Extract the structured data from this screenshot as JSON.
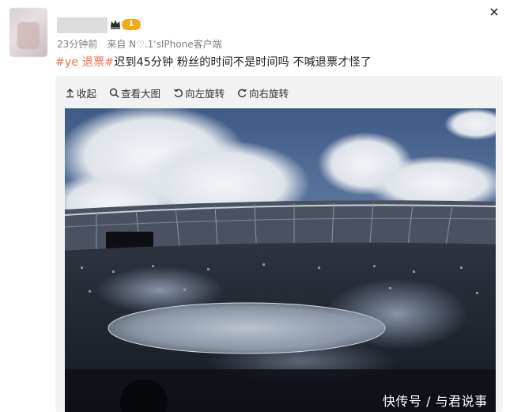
{
  "post": {
    "username": "",
    "level": "1",
    "time": "23分钟前",
    "source_prefix": "来自",
    "source_name": "N♡.1'sIPhone客户端",
    "text_tag1": "#ye 退票#",
    "text_body": "迟到45分钟 粉丝的时间不是时间吗 不喊退票才怪了"
  },
  "toolbar": {
    "collapse_label": "收起",
    "view_large_label": "查看大图",
    "rotate_left_label": "向左旋转",
    "rotate_right_label": "向右旋转"
  },
  "watermark": {
    "text": "快传号 / 与君说事"
  },
  "colors": {
    "tag": "#eb7350",
    "badge": "#f0a91c",
    "media_bg": "#f2f2f2"
  },
  "icons": [
    "crown-icon",
    "close-icon",
    "collapse-arrow-icon",
    "search-icon",
    "rotate-left-icon",
    "rotate-right-icon"
  ]
}
